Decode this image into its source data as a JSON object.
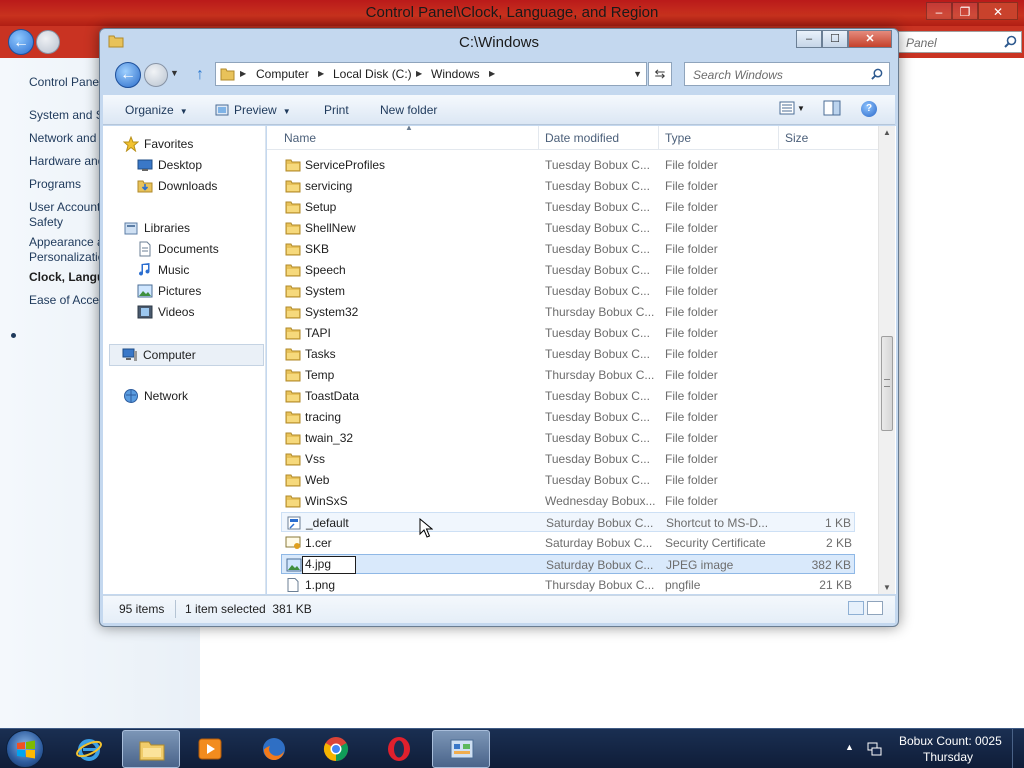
{
  "control_panel": {
    "title": "Control Panel\\Clock, Language, and Region",
    "search_placeholder": "Panel",
    "nav_items": [
      {
        "label": "Control Panel Home"
      },
      {
        "label": "System and Security"
      },
      {
        "label": "Network and Internet"
      },
      {
        "label": "Hardware and Sound"
      },
      {
        "label": "Programs"
      },
      {
        "label": "User Accounts and Family Safety"
      },
      {
        "label": "Appearance and Personalization"
      },
      {
        "label": "Clock, Language, and Region"
      },
      {
        "label": "Ease of Access"
      }
    ]
  },
  "explorer": {
    "title": "C:\\Windows",
    "breadcrumbs": [
      "Computer",
      "Local Disk (C:)",
      "Windows"
    ],
    "search_placeholder": "Search Windows",
    "toolbar": {
      "organize": "Organize",
      "preview": "Preview",
      "print": "Print",
      "new_folder": "New folder"
    },
    "nav_pane": {
      "favorites": "Favorites",
      "desktop": "Desktop",
      "downloads": "Downloads",
      "libraries": "Libraries",
      "documents": "Documents",
      "music": "Music",
      "pictures": "Pictures",
      "videos": "Videos",
      "computer": "Computer",
      "network": "Network"
    },
    "columns": {
      "name": "Name",
      "date": "Date modified",
      "type": "Type",
      "size": "Size"
    },
    "files": [
      {
        "name": "ServiceProfiles",
        "date": "Tuesday Bobux C...",
        "type": "File folder",
        "size": "",
        "icon": "folder-icon"
      },
      {
        "name": "servicing",
        "date": "Tuesday Bobux C...",
        "type": "File folder",
        "size": "",
        "icon": "folder-icon"
      },
      {
        "name": "Setup",
        "date": "Tuesday Bobux C...",
        "type": "File folder",
        "size": "",
        "icon": "folder-icon"
      },
      {
        "name": "ShellNew",
        "date": "Tuesday Bobux C...",
        "type": "File folder",
        "size": "",
        "icon": "folder-icon"
      },
      {
        "name": "SKB",
        "date": "Tuesday Bobux C...",
        "type": "File folder",
        "size": "",
        "icon": "folder-icon"
      },
      {
        "name": "Speech",
        "date": "Tuesday Bobux C...",
        "type": "File folder",
        "size": "",
        "icon": "folder-icon"
      },
      {
        "name": "System",
        "date": "Tuesday Bobux C...",
        "type": "File folder",
        "size": "",
        "icon": "folder-icon"
      },
      {
        "name": "System32",
        "date": "Thursday Bobux C...",
        "type": "File folder",
        "size": "",
        "icon": "folder-icon"
      },
      {
        "name": "TAPI",
        "date": "Tuesday Bobux C...",
        "type": "File folder",
        "size": "",
        "icon": "folder-icon"
      },
      {
        "name": "Tasks",
        "date": "Tuesday Bobux C...",
        "type": "File folder",
        "size": "",
        "icon": "folder-icon"
      },
      {
        "name": "Temp",
        "date": "Thursday Bobux C...",
        "type": "File folder",
        "size": "",
        "icon": "folder-icon"
      },
      {
        "name": "ToastData",
        "date": "Tuesday Bobux C...",
        "type": "File folder",
        "size": "",
        "icon": "folder-icon"
      },
      {
        "name": "tracing",
        "date": "Tuesday Bobux C...",
        "type": "File folder",
        "size": "",
        "icon": "folder-icon"
      },
      {
        "name": "twain_32",
        "date": "Tuesday Bobux C...",
        "type": "File folder",
        "size": "",
        "icon": "folder-icon"
      },
      {
        "name": "Vss",
        "date": "Tuesday Bobux C...",
        "type": "File folder",
        "size": "",
        "icon": "folder-icon"
      },
      {
        "name": "Web",
        "date": "Tuesday Bobux C...",
        "type": "File folder",
        "size": "",
        "icon": "folder-icon"
      },
      {
        "name": "WinSxS",
        "date": "Wednesday Bobux...",
        "type": "File folder",
        "size": "",
        "icon": "folder-icon"
      },
      {
        "name": "_default",
        "date": "Saturday Bobux C...",
        "type": "Shortcut to MS-D...",
        "size": "1 KB",
        "icon": "shortcut-icon",
        "state": "hovered"
      },
      {
        "name": "1.cer",
        "date": "Saturday Bobux C...",
        "type": "Security Certificate",
        "size": "2 KB",
        "icon": "certificate-icon"
      },
      {
        "name": "4.jpg",
        "date": "Saturday Bobux C...",
        "type": "JPEG image",
        "size": "382 KB",
        "icon": "image-icon",
        "state": "selected-renaming"
      },
      {
        "name": "1.png",
        "date": "Thursday Bobux C...",
        "type": "pngfile",
        "size": "21 KB",
        "icon": "file-icon"
      }
    ],
    "status": {
      "item_count": "95 items",
      "selection": "1 item selected  381 KB"
    }
  },
  "taskbar": {
    "apps": [
      {
        "name": "ie-icon",
        "active": false
      },
      {
        "name": "file-explorer-icon",
        "active": true
      },
      {
        "name": "media-player-icon",
        "active": false
      },
      {
        "name": "firefox-icon",
        "active": false
      },
      {
        "name": "chrome-icon",
        "active": false
      },
      {
        "name": "opera-icon",
        "active": false
      },
      {
        "name": "control-panel-icon",
        "active": true
      }
    ],
    "clock_line1": "Bobux Count: 0025",
    "clock_line2": "Thursday"
  },
  "colors": {
    "cp_titlebar": "#c8321e",
    "explorer_frame": "#c4d8ef",
    "selection": "#d9e9fb",
    "taskbar": "#14264a"
  }
}
